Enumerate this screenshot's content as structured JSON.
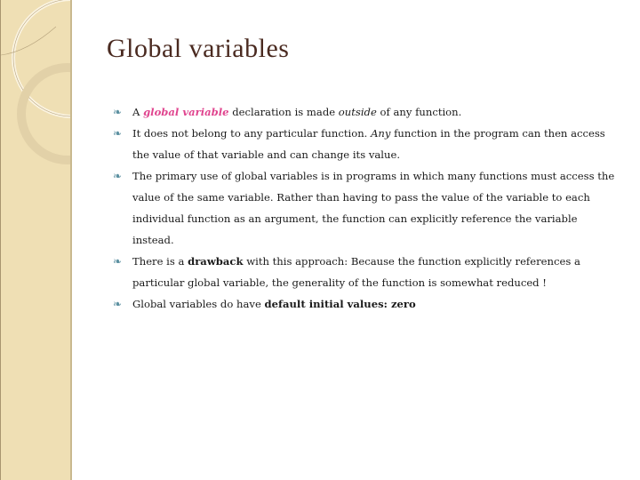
{
  "slide": {
    "title": "Global variables",
    "bullet_icon": "scroll-bullet-icon",
    "bullets": [
      {
        "pre": "A ",
        "emph_pink": "global variable",
        "mid": " declaration is made ",
        "italic": "outside",
        "post": " of any function."
      },
      {
        "pre": "It does not belong to any particular function. ",
        "italic": "Any",
        "post": " function in the program can then access the value of that variable and can change its value."
      },
      {
        "text": "The primary use of global variables is in programs in which many functions must access the value of the same variable. Rather than having to pass the value of the variable to each individual function as an argument, the function can explicitly reference the variable instead."
      },
      {
        "pre": "There is a ",
        "bold": "drawback",
        "post": " with this approach:  Because the function explicitly  references a particular global variable, the generality of the function is somewhat reduced !"
      },
      {
        "pre": "Global variables do have ",
        "bold": "default initial values: zero"
      }
    ]
  },
  "colors": {
    "title": "#4a2a20",
    "accent_pink": "#e0458f",
    "bullet": "#5a8fa0",
    "sidebar": "#efdfb4"
  }
}
